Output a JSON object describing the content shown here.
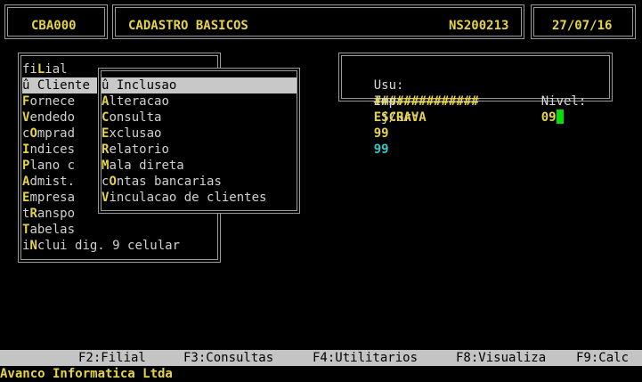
{
  "header": {
    "program_code": "CBA000",
    "title": "CADASTRO BASICOS",
    "module_code": "NS200213",
    "date": "27/07/16"
  },
  "info": {
    "user_label": "Usu:",
    "user_value": "##############",
    "store_label": "Lj/Gr:",
    "store_value": "99",
    "group_value": "99",
    "printer_label": "Imp:",
    "printer_value": "ESCRAVA",
    "level_label": "Nivel:",
    "level_value": "09"
  },
  "main_menu": {
    "items": [
      {
        "pre": "fi",
        "key": "L",
        "post": "ial"
      },
      {
        "pre": "û ",
        "key": "C",
        "post": "liente",
        "selected": true
      },
      {
        "pre": "",
        "key": "F",
        "post": "ornece"
      },
      {
        "pre": "",
        "key": "V",
        "post": "endedo"
      },
      {
        "pre": "c",
        "key": "O",
        "post": "mprad"
      },
      {
        "pre": "",
        "key": "I",
        "post": "ndices"
      },
      {
        "pre": "",
        "key": "P",
        "post": "lano c"
      },
      {
        "pre": "",
        "key": "A",
        "post": "dmist."
      },
      {
        "pre": "",
        "key": "E",
        "post": "mpresa"
      },
      {
        "pre": "t",
        "key": "R",
        "post": "anspo"
      },
      {
        "pre": "",
        "key": "T",
        "post": "abelas"
      },
      {
        "pre": "i",
        "key": "N",
        "post": "clui dig. 9 celular"
      }
    ]
  },
  "sub_menu": {
    "items": [
      {
        "pre": "û ",
        "key": "",
        "post": "Inclusao",
        "selected": true
      },
      {
        "pre": "",
        "key": "A",
        "post": "lteracao"
      },
      {
        "pre": "",
        "key": "C",
        "post": "onsulta"
      },
      {
        "pre": "",
        "key": "E",
        "post": "xclusao"
      },
      {
        "pre": "",
        "key": "R",
        "post": "elatorio"
      },
      {
        "pre": "",
        "key": "M",
        "post": "ala direta"
      },
      {
        "pre": "c",
        "key": "O",
        "post": "ntas bancarias"
      },
      {
        "pre": "",
        "key": "V",
        "post": "inculacao de clientes"
      }
    ]
  },
  "function_keys": [
    "F2:Filial",
    "F3:Consultas",
    "F4:Utilitarios",
    "F8:Visualiza",
    "F9:Calc"
  ],
  "footer": {
    "company": "Avanco Informatica Ltda"
  }
}
